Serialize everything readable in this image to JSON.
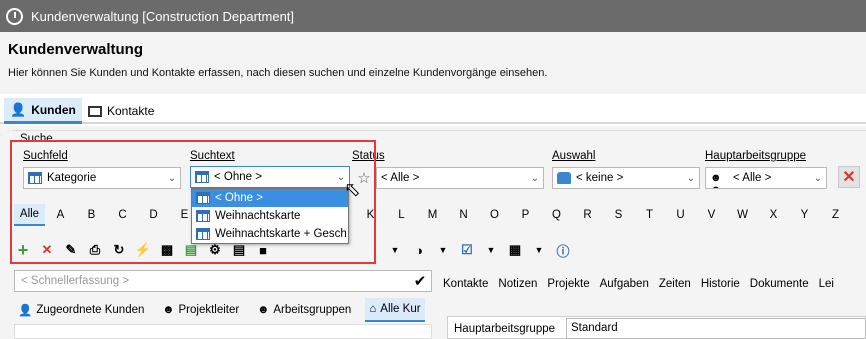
{
  "window": {
    "title": "Kundenverwaltung [Construction Department]"
  },
  "header": {
    "title": "Kundenverwaltung",
    "subtitle": "Hier können Sie Kunden und Kontakte erfassen, nach diesen suchen und einzelne Kundenvorgänge einsehen."
  },
  "tabs": [
    {
      "label": "Kunden"
    },
    {
      "label": "Kontakte"
    }
  ],
  "search": {
    "group_label": "Suche",
    "suchfeld": {
      "label": "Suchfeld",
      "value": "Kategorie"
    },
    "suchtext": {
      "label": "Suchtext",
      "value": "< Ohne >"
    },
    "status": {
      "label": "Status",
      "value": "< Alle >"
    },
    "auswahl": {
      "label": "Auswahl",
      "value": "< keine >"
    },
    "hauptarbeitsgruppe": {
      "label": "Hauptarbeitsgruppe",
      "value": "< Alle >"
    }
  },
  "dropdown": {
    "options": [
      "< Ohne >",
      "Weihnachtskarte",
      "Weihnachtskarte + Gesch"
    ]
  },
  "letters": [
    "Alle",
    "A",
    "B",
    "C",
    "D",
    "E",
    "F",
    "G",
    "H",
    "I",
    "J",
    "K",
    "L",
    "M",
    "N",
    "O",
    "P",
    "Q",
    "R",
    "S",
    "T",
    "U",
    "V",
    "W",
    "X",
    "Y",
    "Z"
  ],
  "quick_entry": {
    "placeholder": "< Schnellerfassung >"
  },
  "subtabs": [
    {
      "label": "Zugeordnete Kunden"
    },
    {
      "label": "Projektleiter"
    },
    {
      "label": "Arbeitsgruppen"
    },
    {
      "label": "Alle Kur"
    }
  ],
  "right_tabs": [
    "Kontakte",
    "Notizen",
    "Projekte",
    "Aufgaben",
    "Zeiten",
    "Historie",
    "Dokumente",
    "Lei"
  ],
  "detail": {
    "label": "Hauptarbeitsgruppe",
    "value": "Standard"
  },
  "colors": {
    "accent": "#3a87d0",
    "highlight": "#e0393e",
    "titlebar": "#6b6b6b"
  }
}
